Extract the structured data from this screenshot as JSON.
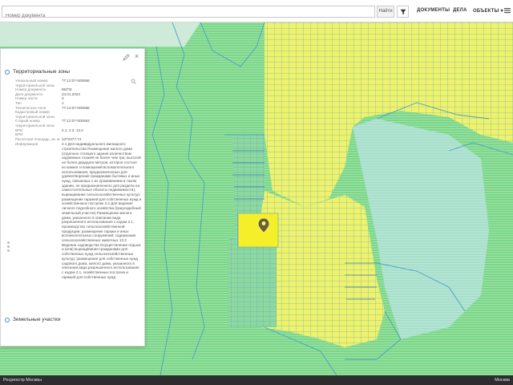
{
  "search": {
    "placeholder": "Номер документа"
  },
  "toolbar": {
    "find_label": "Найти"
  },
  "nav": {
    "documents": "ДОКУМЕНТЫ",
    "cases": "ДЕЛА",
    "objects": "ОБЪЕКТЫ"
  },
  "panel": {
    "zones_title": "Территориальные зоны",
    "plots_title": "Земельные участки",
    "rows": [
      {
        "key": "Уникальный номер территориальной зоны",
        "value": "77:12:07-000666"
      },
      {
        "key": "Номер документа",
        "value": "86/ПЗ"
      },
      {
        "key": "Дата документа",
        "value": "24.01.2024"
      },
      {
        "key": "Номер листа",
        "value": "0"
      },
      {
        "key": "Тип",
        "value": "1"
      },
      {
        "key": "Техническое поле",
        "value": "77:12:07-000666"
      },
      {
        "key": "Кадастровый номер территориальной зоны",
        "value": ""
      },
      {
        "key": "Старый номер территориальной зоны",
        "value": "77:12:07-000663"
      },
      {
        "key": "ВРИ",
        "value": "2.1; 2.2; 13.2"
      },
      {
        "key": "ВРИ",
        "value": ""
      },
      {
        "key": "Расчетная площадь, кв. м",
        "value": "2372477,74"
      }
    ],
    "info_key": "Информация",
    "info_text": "2.1 Для индивидуального жилищного строительства Размещение жилого дома (отдельно стоящего здания количеством надземных этажей не более чем три, высотой не более двадцати метров, которое состоит из комнат и помещений вспомогательного использования, предназначенных для удовлетворения гражданами бытовых и иных нужд, связанных с их проживанием в таком здании, не предназначенного для раздела на самостоятельные объекты недвижимости); выращивание сельскохозяйственных культур; размещение гаражей для собственных нужд и хозяйственных построек 2.2 Для ведения личного подсобного хозяйства (приусадебный земельный участок) Размещение жилого дома, указанного в описании вида разрешенного использования с кодом 2.1; производство сельскохозяйственной продукции; размещение гаража и иных вспомогательных сооружений; содержание сельскохозяйственных животных 13.2 Ведение садоводства Осуществление отдыха и (или) выращивания гражданами для собственных нужд сельскохозяйственных культур; размещение для собственных нужд садового дома, жилого дома, указанного в описании вида разрешенного использования с кодом 2.1, хозяйственных построек и гаражей для собственных нужд"
  },
  "footer": {
    "left": "Росреестр Москвы",
    "right": "Москва"
  },
  "map": {
    "marker": "map-pin-icon",
    "colors": {
      "zone_yellow": "#f0f07a",
      "zone_green": "#7fd98f",
      "boundary": "#4a9fc6",
      "selected": "#f5f02a"
    }
  }
}
